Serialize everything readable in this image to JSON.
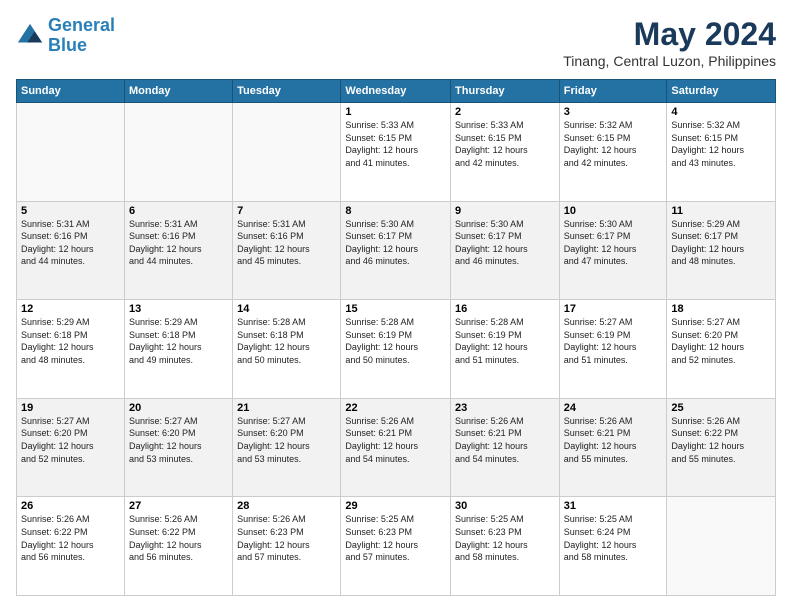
{
  "logo": {
    "line1": "General",
    "line2": "Blue"
  },
  "title": "May 2024",
  "subtitle": "Tinang, Central Luzon, Philippines",
  "headers": [
    "Sunday",
    "Monday",
    "Tuesday",
    "Wednesday",
    "Thursday",
    "Friday",
    "Saturday"
  ],
  "weeks": [
    [
      {
        "day": "",
        "info": ""
      },
      {
        "day": "",
        "info": ""
      },
      {
        "day": "",
        "info": ""
      },
      {
        "day": "1",
        "info": "Sunrise: 5:33 AM\nSunset: 6:15 PM\nDaylight: 12 hours\nand 41 minutes."
      },
      {
        "day": "2",
        "info": "Sunrise: 5:33 AM\nSunset: 6:15 PM\nDaylight: 12 hours\nand 42 minutes."
      },
      {
        "day": "3",
        "info": "Sunrise: 5:32 AM\nSunset: 6:15 PM\nDaylight: 12 hours\nand 42 minutes."
      },
      {
        "day": "4",
        "info": "Sunrise: 5:32 AM\nSunset: 6:15 PM\nDaylight: 12 hours\nand 43 minutes."
      }
    ],
    [
      {
        "day": "5",
        "info": "Sunrise: 5:31 AM\nSunset: 6:16 PM\nDaylight: 12 hours\nand 44 minutes."
      },
      {
        "day": "6",
        "info": "Sunrise: 5:31 AM\nSunset: 6:16 PM\nDaylight: 12 hours\nand 44 minutes."
      },
      {
        "day": "7",
        "info": "Sunrise: 5:31 AM\nSunset: 6:16 PM\nDaylight: 12 hours\nand 45 minutes."
      },
      {
        "day": "8",
        "info": "Sunrise: 5:30 AM\nSunset: 6:17 PM\nDaylight: 12 hours\nand 46 minutes."
      },
      {
        "day": "9",
        "info": "Sunrise: 5:30 AM\nSunset: 6:17 PM\nDaylight: 12 hours\nand 46 minutes."
      },
      {
        "day": "10",
        "info": "Sunrise: 5:30 AM\nSunset: 6:17 PM\nDaylight: 12 hours\nand 47 minutes."
      },
      {
        "day": "11",
        "info": "Sunrise: 5:29 AM\nSunset: 6:17 PM\nDaylight: 12 hours\nand 48 minutes."
      }
    ],
    [
      {
        "day": "12",
        "info": "Sunrise: 5:29 AM\nSunset: 6:18 PM\nDaylight: 12 hours\nand 48 minutes."
      },
      {
        "day": "13",
        "info": "Sunrise: 5:29 AM\nSunset: 6:18 PM\nDaylight: 12 hours\nand 49 minutes."
      },
      {
        "day": "14",
        "info": "Sunrise: 5:28 AM\nSunset: 6:18 PM\nDaylight: 12 hours\nand 50 minutes."
      },
      {
        "day": "15",
        "info": "Sunrise: 5:28 AM\nSunset: 6:19 PM\nDaylight: 12 hours\nand 50 minutes."
      },
      {
        "day": "16",
        "info": "Sunrise: 5:28 AM\nSunset: 6:19 PM\nDaylight: 12 hours\nand 51 minutes."
      },
      {
        "day": "17",
        "info": "Sunrise: 5:27 AM\nSunset: 6:19 PM\nDaylight: 12 hours\nand 51 minutes."
      },
      {
        "day": "18",
        "info": "Sunrise: 5:27 AM\nSunset: 6:20 PM\nDaylight: 12 hours\nand 52 minutes."
      }
    ],
    [
      {
        "day": "19",
        "info": "Sunrise: 5:27 AM\nSunset: 6:20 PM\nDaylight: 12 hours\nand 52 minutes."
      },
      {
        "day": "20",
        "info": "Sunrise: 5:27 AM\nSunset: 6:20 PM\nDaylight: 12 hours\nand 53 minutes."
      },
      {
        "day": "21",
        "info": "Sunrise: 5:27 AM\nSunset: 6:20 PM\nDaylight: 12 hours\nand 53 minutes."
      },
      {
        "day": "22",
        "info": "Sunrise: 5:26 AM\nSunset: 6:21 PM\nDaylight: 12 hours\nand 54 minutes."
      },
      {
        "day": "23",
        "info": "Sunrise: 5:26 AM\nSunset: 6:21 PM\nDaylight: 12 hours\nand 54 minutes."
      },
      {
        "day": "24",
        "info": "Sunrise: 5:26 AM\nSunset: 6:21 PM\nDaylight: 12 hours\nand 55 minutes."
      },
      {
        "day": "25",
        "info": "Sunrise: 5:26 AM\nSunset: 6:22 PM\nDaylight: 12 hours\nand 55 minutes."
      }
    ],
    [
      {
        "day": "26",
        "info": "Sunrise: 5:26 AM\nSunset: 6:22 PM\nDaylight: 12 hours\nand 56 minutes."
      },
      {
        "day": "27",
        "info": "Sunrise: 5:26 AM\nSunset: 6:22 PM\nDaylight: 12 hours\nand 56 minutes."
      },
      {
        "day": "28",
        "info": "Sunrise: 5:26 AM\nSunset: 6:23 PM\nDaylight: 12 hours\nand 57 minutes."
      },
      {
        "day": "29",
        "info": "Sunrise: 5:25 AM\nSunset: 6:23 PM\nDaylight: 12 hours\nand 57 minutes."
      },
      {
        "day": "30",
        "info": "Sunrise: 5:25 AM\nSunset: 6:23 PM\nDaylight: 12 hours\nand 58 minutes."
      },
      {
        "day": "31",
        "info": "Sunrise: 5:25 AM\nSunset: 6:24 PM\nDaylight: 12 hours\nand 58 minutes."
      },
      {
        "day": "",
        "info": ""
      }
    ]
  ]
}
